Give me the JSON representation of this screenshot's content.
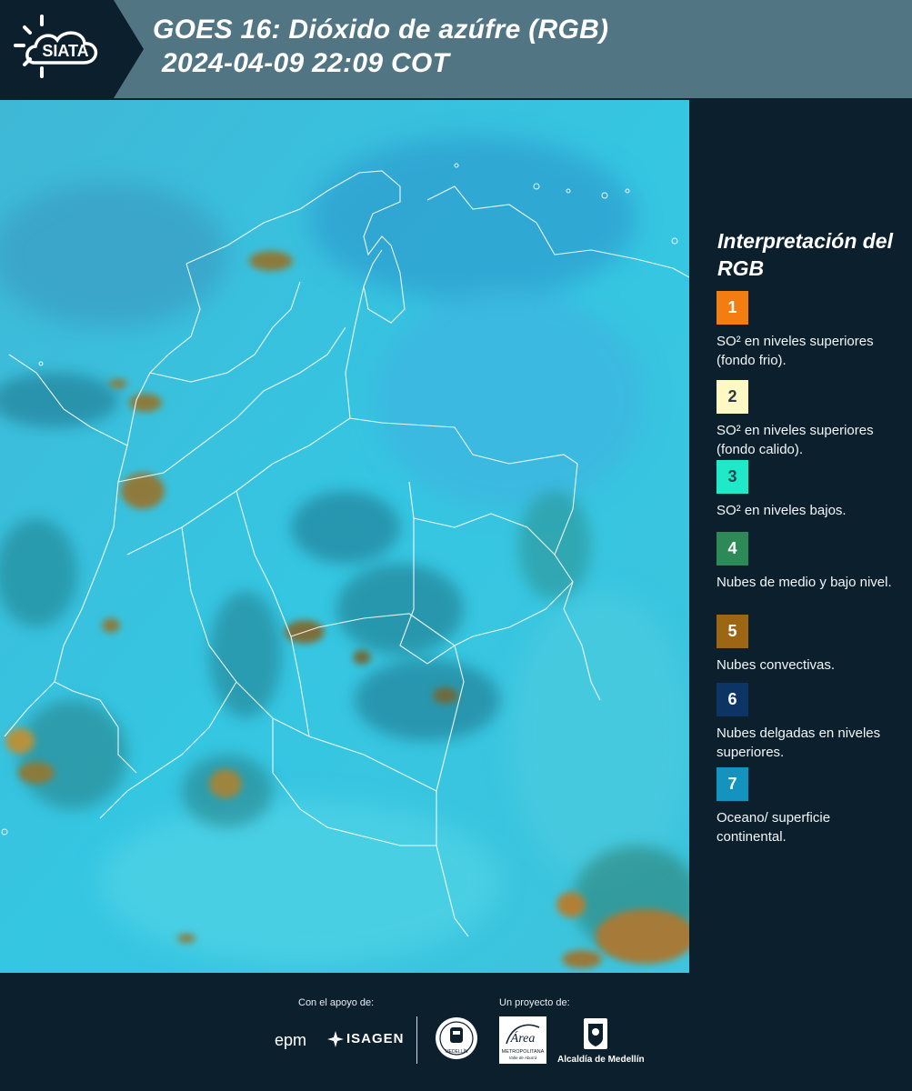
{
  "header": {
    "logo_text": "SIATA",
    "title_line1": "GOES 16: Dióxido de azúfre (RGB)",
    "title_line2": "2024-04-09 22:09 COT"
  },
  "legend": {
    "title": "Interpretación del RGB",
    "items": [
      {
        "number": "1",
        "color": "#f47d12",
        "text_color": "#ffffff",
        "text": "SO² en niveles superiores (fondo frio)."
      },
      {
        "number": "2",
        "color": "#fdf8c4",
        "text_color": "#2f3a40",
        "text": "SO² en niveles superiores (fondo calido)."
      },
      {
        "number": "3",
        "color": "#1fe9c9",
        "text_color": "#1c4a52",
        "text": "SO² en niveles bajos."
      },
      {
        "number": "4",
        "color": "#2d8a58",
        "text_color": "#ffffff",
        "text": "Nubes de medio y bajo nivel."
      },
      {
        "number": "5",
        "color": "#9c6614",
        "text_color": "#ffffff",
        "text": "Nubes convectivas."
      },
      {
        "number": "6",
        "color": "#0c3566",
        "text_color": "#ffffff",
        "text": "Nubes delgadas en niveles superiores."
      },
      {
        "number": "7",
        "color": "#1593bf",
        "text_color": "#ffffff",
        "text": "Oceano/ superficie continental."
      }
    ]
  },
  "footer": {
    "support_label": "Con el apoyo de:",
    "project_label": "Un proyecto de:",
    "support_logos": [
      "epm",
      "ISAGEN"
    ],
    "project_logos": [
      "MEDELLÍN",
      "Área",
      "METROPOLITANA",
      "Valle de Aburrá",
      "Alcaldía de Medellín"
    ]
  },
  "colors": {
    "header_bg": "#527583",
    "logo_bg": "#0c1f2c",
    "panel_bg": "#0c1f2c",
    "map_base": "#33c4e0"
  }
}
